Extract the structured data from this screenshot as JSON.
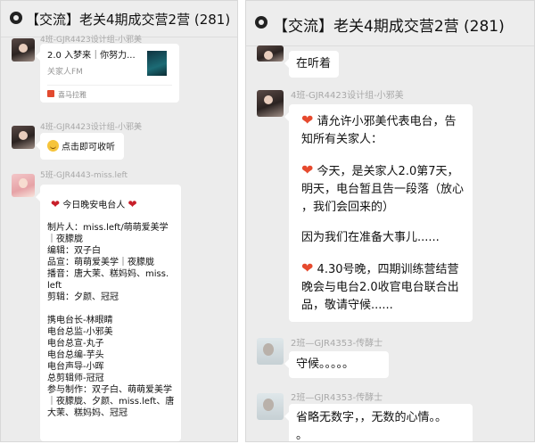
{
  "left": {
    "title": "【交流】老关4期成交营2营 (281)",
    "top_nick": "4班-GJR4423设计组-小邪美",
    "card": {
      "title": "2.0 入梦来｜你努力...",
      "account": "关家人FM",
      "source": "喜马拉雅"
    },
    "msg2_nick": "4班-GJR4423设计组-小邪美",
    "msg2_text": "点击即可收听",
    "msg3_nick": "5班-GJR4443-miss.left",
    "msg3_lines": [
      "今日晚安电台人",
      "制片人：miss.left/萌萌爱美学",
      "｜夜朦胧",
      "编辑：双子白",
      "品宣：萌萌爱美学｜夜朦胧",
      "播音：唐大茉、糕妈妈、miss.",
      "left",
      "剪辑：夕颜、冠冠",
      "携电台长-林眼睛",
      "电台总监-小邪美",
      "电台总宣-丸子",
      "电台总编-芋头",
      "电台声导-小晖",
      "总剪辑师-冠冠",
      "参与制作：双子白、萌萌爱美学",
      "｜夜朦胧、夕颜、miss.left、唐",
      "大茉、糕妈妈、冠冠"
    ]
  },
  "right": {
    "title": "【交流】老关4期成交营2营 (281)",
    "msg1_text": "在听着",
    "msg2_nick": "4班-GJR4423设计组-小邪美",
    "msg2_lines": [
      "请允许小邪美代表电台，告",
      "知所有关家人：",
      "今天，是关家人2.0第7天，",
      "明天，电台暂且告一段落（放心",
      "，我们会回来的）",
      "因为我们在准备大事儿......",
      "4.30号晚，四期训练营结营",
      "晚会与电台2.0收官电台联合出",
      "品，敬请守候......"
    ],
    "msg3_nick": "2班—GJR4353-传酵士",
    "msg3_text": "守候。。。。。",
    "msg4_nick": "2班—GJR4353-传酵士",
    "msg4_lines": [
      "省略无数字，，无数的心情。。",
      "。"
    ]
  },
  "icons": {
    "header": "chat-group-icon",
    "heart": "heart-icon",
    "smile": "smile-emoji-icon"
  },
  "colors": {
    "chat_bg": "#ececec",
    "bubble": "#ffffff",
    "nickname": "#a8a8a8",
    "heart": "#e64a2e",
    "source_badge": "#e24a2f"
  }
}
